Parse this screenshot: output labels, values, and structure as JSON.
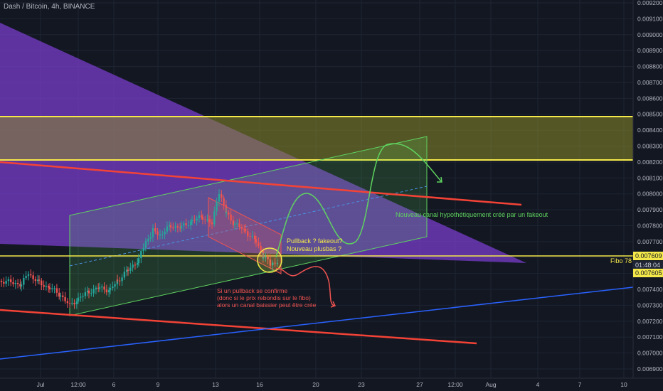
{
  "header": {
    "title": "Dash / Bitcoin, 4h, BINANCE"
  },
  "colors": {
    "background": "#131722",
    "grid": "#1e2433",
    "axis_text": "#b2b5be",
    "bull": "#26a69a",
    "bear": "#ef5350",
    "yellow": "#f5e94a",
    "red_line": "#f44336",
    "blue_line": "#2962ff",
    "green_channel": "#5fd35f",
    "purple_zone": "#7b3fd1"
  },
  "price_axis": {
    "labels": [
      "0.009200",
      "0.009100",
      "0.009000",
      "0.008900",
      "0.008800",
      "0.008700",
      "0.008600",
      "0.008500",
      "0.008400",
      "0.008300",
      "0.008200",
      "0.008100",
      "0.008000",
      "0.007900",
      "0.007800",
      "0.007700",
      "0.007600",
      "0.007500",
      "0.007400",
      "0.007300",
      "0.007200",
      "0.007100",
      "0.007000",
      "0.006900"
    ],
    "tag_fibo": "0.007609",
    "tag_countdown": "01:48:04",
    "tag_last": "0.007605"
  },
  "time_axis": {
    "labels": [
      "Jul",
      "12:00",
      "6",
      "9",
      "13",
      "16",
      "20",
      "23",
      "27",
      "12:00",
      "Aug",
      "4",
      "7",
      "10"
    ]
  },
  "annotations": {
    "pullback": "Pullback ? fakeout?",
    "plusbas": "Nouveau plusbas ?",
    "nouveau_canal": "Nouveau canal hypothétiquement créé par un fakeout",
    "bear_line1": "Si un pullback se confirme",
    "bear_line2": "(donc si le prix rebondis sur le fibo)",
    "bear_line3": "alors un canal baissier peut être crée",
    "fibo": "Fibo 78"
  },
  "chart_data": {
    "type": "candlestick",
    "title": "Dash / Bitcoin, 4h, BINANCE",
    "y_range": [
      0.00685,
      0.00921
    ],
    "horizontal_levels": [
      0.00848,
      0.00821,
      0.007609
    ],
    "last_price": 0.007605,
    "x_ticks": [
      "Jul",
      "12:00",
      "6",
      "9",
      "13",
      "16",
      "20",
      "23",
      "27",
      "12:00",
      "Aug",
      "4",
      "7",
      "10"
    ],
    "grid": true
  }
}
